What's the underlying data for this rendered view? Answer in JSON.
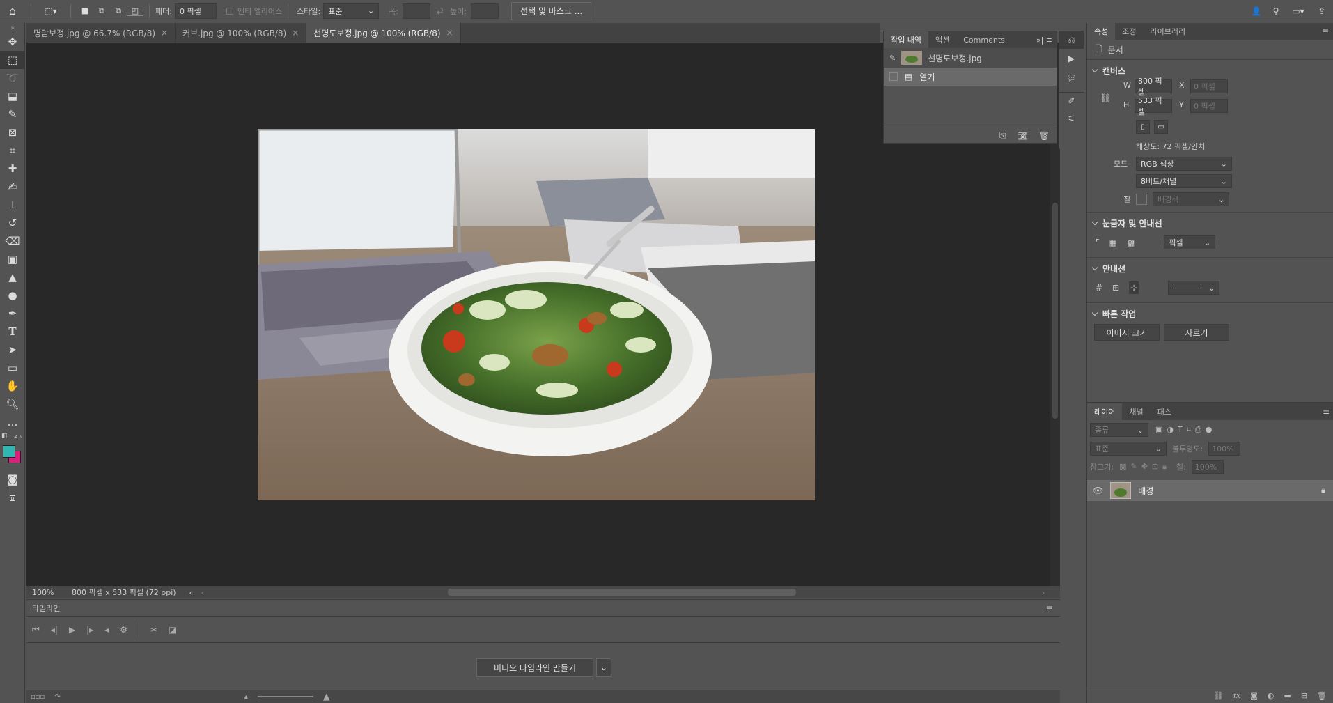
{
  "options_bar": {
    "feather_label": "페더:",
    "feather_value": "0 픽셀",
    "antialias_label": "앤티 앨리어스",
    "style_label": "스타일:",
    "style_value": "표준",
    "width_label": "폭:",
    "height_label": "높이:",
    "select_mask_button": "선택 및 마스크 ..."
  },
  "doc_tabs": [
    {
      "label": "명암보정.jpg @ 66.7% (RGB/8)",
      "active": false
    },
    {
      "label": "커브.jpg @ 100% (RGB/8)",
      "active": false
    },
    {
      "label": "선명도보정.jpg @ 100% (RGB/8)",
      "active": true
    }
  ],
  "status_bar": {
    "zoom": "100%",
    "doc_info": "800 픽셀 x 533 픽셀 (72 ppi)"
  },
  "timeline": {
    "title": "타임라인",
    "create_button": "비디오 타임라인 만들기"
  },
  "history_panel": {
    "tabs": [
      "작업 내역",
      "액션",
      "Comments"
    ],
    "snapshot_name": "선명도보정.jpg",
    "steps": [
      "열기"
    ]
  },
  "properties_panel": {
    "tabs": [
      "속성",
      "조정",
      "라이브러리"
    ],
    "doc_label": "문서",
    "canvas_section": "캔버스",
    "w_label": "W",
    "w_value": "800 픽셀",
    "h_label": "H",
    "h_value": "533 픽셀",
    "x_label": "X",
    "x_value": "0 픽셀",
    "y_label": "Y",
    "y_value": "0 픽셀",
    "resolution": "해상도: 72 픽셀/인치",
    "mode_label": "모드",
    "mode_value": "RGB 색상",
    "bit_value": "8비트/채널",
    "fill_label": "칠",
    "fill_value": "배경색",
    "rulers_section": "눈금자 및 안내선",
    "ruler_unit": "픽셀",
    "guides_section": "안내선",
    "quick_section": "빠른 작업",
    "image_size_button": "이미지 크기",
    "crop_button": "자르기"
  },
  "layers_panel": {
    "tabs": [
      "레이어",
      "채널",
      "패스"
    ],
    "filter_placeholder": "종류",
    "blend_mode": "표준",
    "opacity_label": "불투명도:",
    "opacity_value": "100%",
    "lock_label": "잠그기:",
    "fill_label": "칠:",
    "fill_value": "100%",
    "layers": [
      {
        "name": "배경",
        "visible": true,
        "locked": true
      }
    ]
  },
  "colors": {
    "foreground": "#2fb7b4",
    "background": "#d7217c"
  }
}
